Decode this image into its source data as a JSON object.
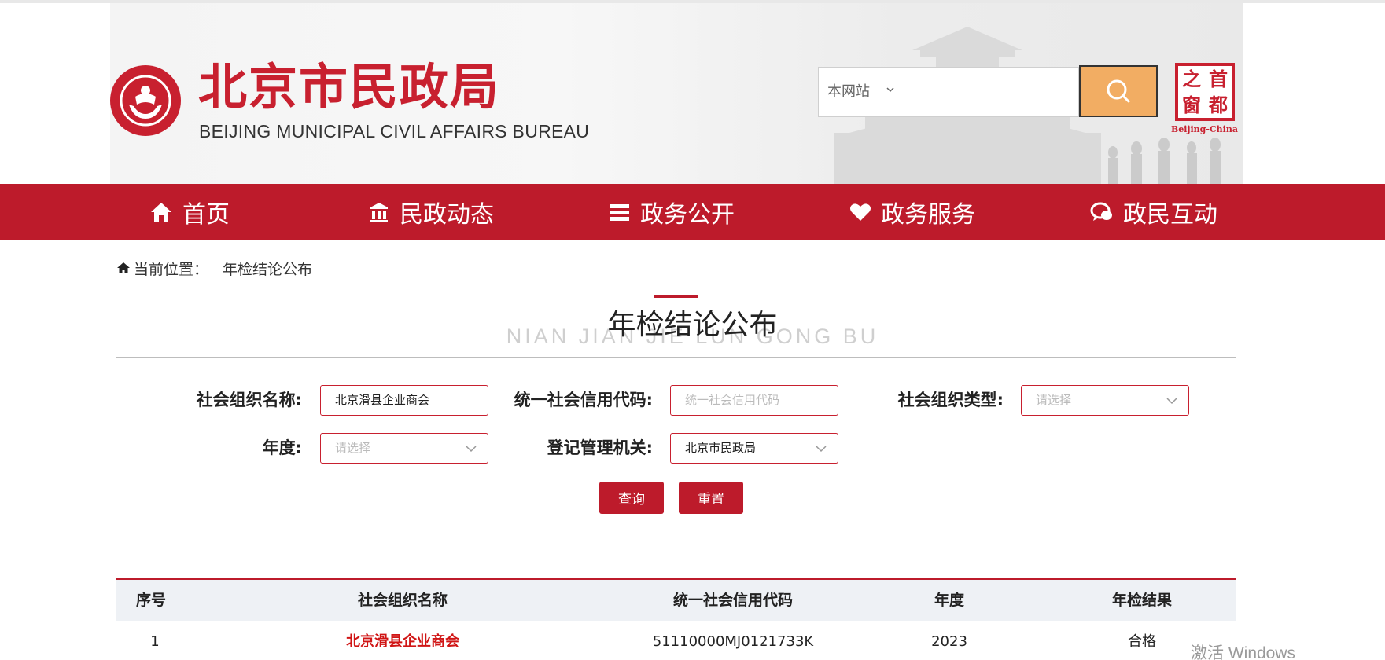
{
  "header": {
    "title_zh": "北京市民政局",
    "title_en": "BEIJING MUNICIPAL CIVIL AFFAIRS BUREAU",
    "search": {
      "scope": "本网站",
      "placeholder": ""
    },
    "capital_badge": {
      "chars": [
        "之",
        "首",
        "窗",
        "都"
      ],
      "caption": "Beijing-China"
    }
  },
  "nav": {
    "items": [
      {
        "label": "首页",
        "icon": "home-icon"
      },
      {
        "label": "民政动态",
        "icon": "bank-icon"
      },
      {
        "label": "政务公开",
        "icon": "list-icon"
      },
      {
        "label": "政务服务",
        "icon": "heart-icon"
      },
      {
        "label": "政民互动",
        "icon": "chat-icon"
      }
    ]
  },
  "breadcrumb": {
    "prefix": "当前位置：",
    "current": "年检结论公布"
  },
  "heading": {
    "zh": "年检结论公布",
    "en": "NIAN JIAN JIE LUN GONG BU"
  },
  "form": {
    "org_name": {
      "label": "社会组织名称:",
      "value": "北京滑县企业商会"
    },
    "credit_code": {
      "label": "统一社会信用代码:",
      "placeholder": "统一社会信用代码"
    },
    "org_type": {
      "label": "社会组织类型:",
      "placeholder": "请选择"
    },
    "year": {
      "label": "年度:",
      "placeholder": "请选择"
    },
    "authority": {
      "label": "登记管理机关:",
      "value": "北京市民政局"
    },
    "query_label": "查询",
    "reset_label": "重置"
  },
  "table": {
    "headers": [
      "序号",
      "社会组织名称",
      "统一社会信用代码",
      "年度",
      "年检结果"
    ],
    "rows": [
      [
        "1",
        "北京滑县企业商会",
        "51110000MJ0121733K",
        "2023",
        "合格"
      ]
    ]
  },
  "watermark": "激活 Windows",
  "colors": {
    "brand_red": "#bd1b2b",
    "search_button": "#f2ad63",
    "link_red": "#d01515"
  }
}
